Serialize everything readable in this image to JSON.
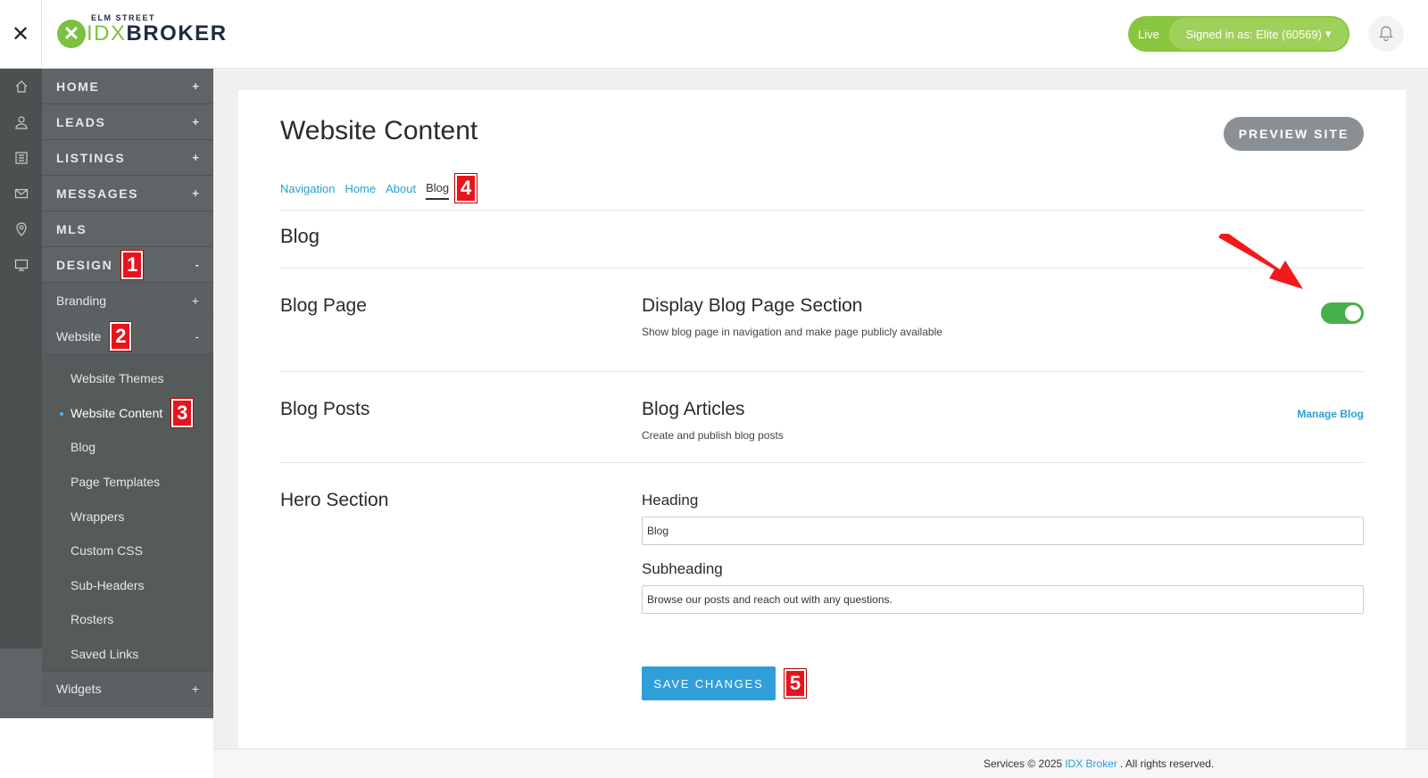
{
  "header": {
    "close_glyph": "✕",
    "logo_top": "ELM STREET",
    "logo_idx": "IDX",
    "logo_broker": "BROKER",
    "live_label": "Live",
    "signed_in": "Signed in as: Elite (60569)"
  },
  "sidebar": {
    "items": {
      "home": "HOME",
      "leads": "LEADS",
      "listings": "LISTINGS",
      "messages": "MESSAGES",
      "mls": "MLS",
      "design": "DESIGN"
    },
    "plus": "+",
    "minus": "-",
    "design_sub": {
      "branding": "Branding",
      "website": "Website",
      "widgets": "Widgets"
    },
    "website_sub": [
      "Website Themes",
      "Website Content",
      "Blog",
      "Page Templates",
      "Wrappers",
      "Custom CSS",
      "Sub-Headers",
      "Rosters",
      "Saved Links"
    ]
  },
  "badges": [
    "1",
    "2",
    "3",
    "4",
    "5"
  ],
  "main": {
    "page_title": "Website Content",
    "preview_button": "PREVIEW SITE",
    "tabs": [
      "Navigation",
      "Home",
      "About",
      "Blog"
    ],
    "section_heading": "Blog",
    "blog_page": {
      "label": "Blog Page",
      "title": "Display Blog Page Section",
      "description": "Show blog page in navigation and make page publicly available",
      "enabled": true
    },
    "blog_posts": {
      "label": "Blog Posts",
      "title": "Blog Articles",
      "description": "Create and publish blog posts",
      "link": "Manage Blog"
    },
    "hero": {
      "label": "Hero Section",
      "heading_label": "Heading",
      "heading_value": "Blog",
      "subheading_label": "Subheading",
      "subheading_value": "Browse our posts and reach out with any questions."
    },
    "save_button": "SAVE CHANGES"
  },
  "footer": {
    "prefix": "Services © 2025",
    "link": "IDX Broker",
    "suffix": ". All rights reserved."
  },
  "colors": {
    "brand_green": "#8ac53f",
    "sidebar": "#5f6566",
    "accent_blue": "#2f9fd9",
    "toggle_on": "#47b04b",
    "annotation_red": "#e8141d"
  }
}
